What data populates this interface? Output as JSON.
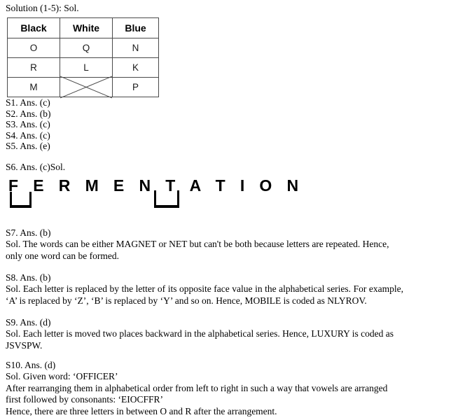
{
  "document": {
    "heading": "Solution (1-5): Sol."
  },
  "arrangement_table": {
    "columns": [
      "Black",
      "White",
      "Blue"
    ],
    "rows": [
      [
        "O",
        "Q",
        "N"
      ],
      [
        "R",
        "L",
        "K"
      ],
      [
        "M",
        "",
        "P"
      ]
    ],
    "crossed_cell": {
      "row": 3,
      "column": "White",
      "marker": "cross-mark"
    }
  },
  "answer_keys": [
    "S1. Ans. (c)",
    "S2. Ans. (b)",
    "S3. Ans. (c)",
    "S4. Ans. (c)",
    "S5. Ans. (e)"
  ],
  "solution_6": {
    "heading": "S6. Ans. (c)Sol.",
    "word": "F E R M E N T A T I O N",
    "bracket_left_label": "underbracket-left",
    "bracket_right_label": "underbracket-right"
  },
  "solutions": [
    {
      "id": "s7",
      "head": "S7. Ans. (b)",
      "body": "Sol. The words can be either MAGNET or NET but can't be both because letters are repeated. Hence, only one word can be formed."
    },
    {
      "id": "s8",
      "head": "S8. Ans. (b)",
      "body": "Sol. Each letter is replaced by the letter of its opposite face value in the alphabetical series. For example, ‘A’ is replaced by ‘Z’, ‘B’ is replaced by ‘Y’ and so on. Hence, MOBILE is coded as NLYROV."
    },
    {
      "id": "s9",
      "head": "S9. Ans. (d)",
      "body": "Sol. Each letter is moved two places backward in the alphabetical series. Hence, LUXURY is coded as JSVSPW."
    }
  ],
  "solution_10": {
    "head": "S10. Ans. (d)",
    "line1": "Sol. Given word: ‘OFFICER’",
    "line2": "After rearranging them in alphabetical order from left to right in such a way that vowels are arranged first followed by consonants: ‘EIOCFFR’",
    "line3": " Hence, there are three letters in between O and R after the arrangement."
  },
  "colors": {
    "text": "#000000",
    "table_border": "#4a4a4a",
    "page_background": "#ffffff"
  }
}
